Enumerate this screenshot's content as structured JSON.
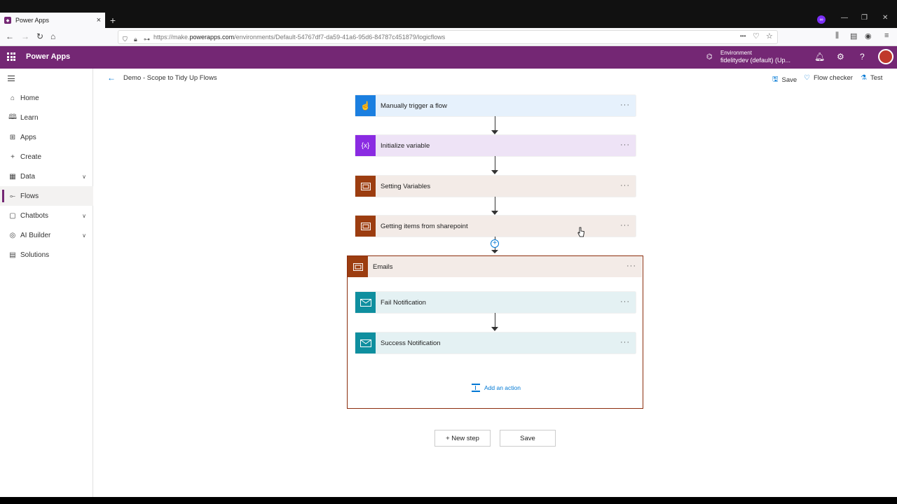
{
  "browser": {
    "tab_title": "Power Apps",
    "tab_close": "×",
    "new_tab": "+",
    "url_prefix": "https://make.",
    "url_domain": "powerapps.com",
    "url_rest": "/environments/Default-54767df7-da59-41a6-95d6-84787c451879/logicflows",
    "page_actions": "•••"
  },
  "header": {
    "app_title": "Power Apps",
    "environment_label": "Environment",
    "environment_value": "fidelitydev (default) (Up...",
    "help": "?"
  },
  "sidebar": {
    "items": [
      {
        "label": "Home",
        "icon": "home-icon"
      },
      {
        "label": "Learn",
        "icon": "book-icon"
      },
      {
        "label": "Apps",
        "icon": "apps-icon"
      },
      {
        "label": "Create",
        "icon": "plus-icon"
      },
      {
        "label": "Data",
        "icon": "table-icon",
        "expandable": true
      },
      {
        "label": "Flows",
        "icon": "flow-icon",
        "active": true
      },
      {
        "label": "Chatbots",
        "icon": "chatbot-icon",
        "expandable": true
      },
      {
        "label": "AI Builder",
        "icon": "ai-builder-icon",
        "expandable": true
      },
      {
        "label": "Solutions",
        "icon": "solutions-icon"
      }
    ]
  },
  "commandbar": {
    "flow_name": "Demo - Scope to Tidy Up Flows",
    "save": "Save",
    "flow_checker": "Flow checker",
    "test": "Test"
  },
  "flow": {
    "steps": [
      {
        "label": "Manually trigger a flow",
        "color": "#1b7fe0",
        "bg": "#e6f1fc",
        "icon": "hand-trigger-icon"
      },
      {
        "label": "Initialize variable",
        "color": "#8a2be2",
        "bg": "#eee3f6",
        "icon": "variable-icon",
        "glyph": "{x}"
      },
      {
        "label": "Setting Variables",
        "color": "#9c3d10",
        "bg": "#f3ebe7",
        "icon": "scope-icon"
      },
      {
        "label": "Getting items from sharepoint",
        "color": "#9c3d10",
        "bg": "#f3ebe7",
        "icon": "scope-icon"
      }
    ],
    "insert_step": "+",
    "step_menu": "···",
    "scope": {
      "label": "Emails",
      "color": "#9c3d10",
      "children": [
        {
          "label": "Fail Notification",
          "color": "#0f8f9f",
          "bg": "#e4f1f3",
          "icon": "mail-icon"
        },
        {
          "label": "Success Notification",
          "color": "#0f8f9f",
          "bg": "#e4f1f3",
          "icon": "mail-icon"
        }
      ],
      "add_action": "Add an action"
    }
  },
  "footer_buttons": {
    "new_step": "+ New step",
    "save": "Save"
  }
}
